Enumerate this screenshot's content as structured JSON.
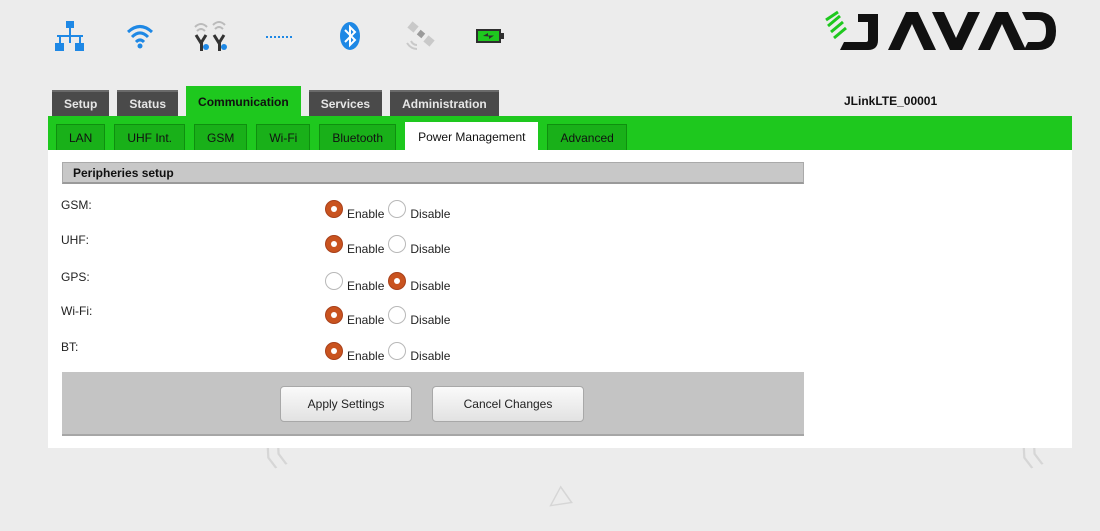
{
  "status_icons": [
    {
      "name": "network-icon"
    },
    {
      "name": "wifi-icon"
    },
    {
      "name": "gsm-antenna-icon"
    },
    {
      "name": "dotted-line-icon"
    },
    {
      "name": "bluetooth-icon"
    },
    {
      "name": "satellite-icon"
    },
    {
      "name": "battery-icon"
    }
  ],
  "logo": {
    "text": "JAVAD"
  },
  "device_name": "JLinkLTE_00001",
  "top_tabs": [
    {
      "label": "Setup",
      "active": false
    },
    {
      "label": "Status",
      "active": false
    },
    {
      "label": "Communication",
      "active": true
    },
    {
      "label": "Services",
      "active": false
    },
    {
      "label": "Administration",
      "active": false
    }
  ],
  "sub_tabs": [
    {
      "label": "LAN",
      "active": false
    },
    {
      "label": "UHF Int.",
      "active": false
    },
    {
      "label": "GSM",
      "active": false
    },
    {
      "label": "Wi-Fi",
      "active": false
    },
    {
      "label": "Bluetooth",
      "active": false
    },
    {
      "label": "Power Management",
      "active": true
    },
    {
      "label": "Advanced",
      "active": false
    }
  ],
  "section": {
    "title": "Peripheries setup"
  },
  "options": {
    "enable": "Enable",
    "disable": "Disable"
  },
  "peripherals": [
    {
      "label": "GSM:",
      "value": "Enable"
    },
    {
      "label": "UHF:",
      "value": "Enable"
    },
    {
      "label": "GPS:",
      "value": "Disable"
    },
    {
      "label": "Wi-Fi:",
      "value": "Enable"
    },
    {
      "label": "BT:",
      "value": "Enable"
    }
  ],
  "buttons": {
    "apply": "Apply Settings",
    "cancel": "Cancel Changes"
  },
  "colors": {
    "accent_green": "#1ec81e",
    "radio_selected": "#c9531f",
    "tab_dark": "#4a4a4a"
  }
}
